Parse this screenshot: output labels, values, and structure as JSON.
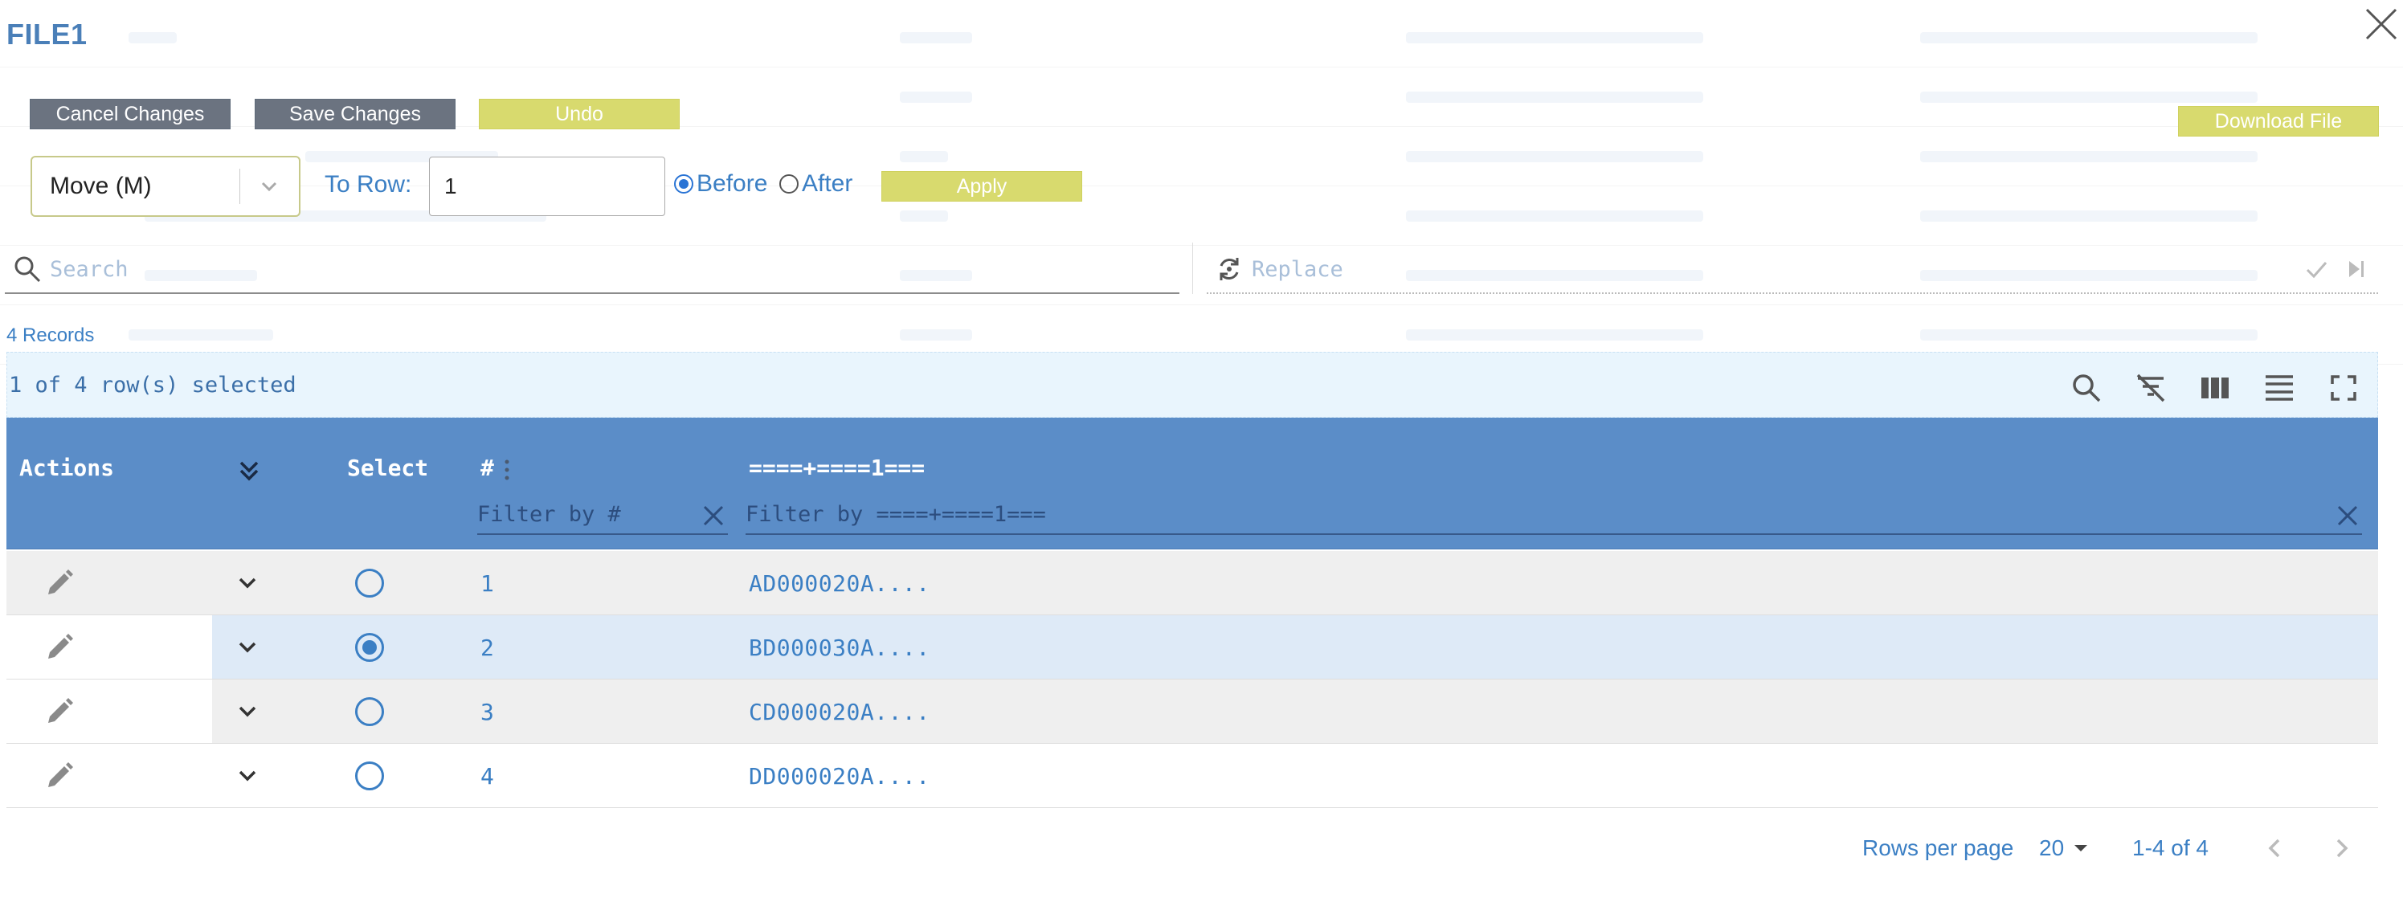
{
  "window": {
    "title": "FILE1"
  },
  "toolbar": {
    "cancel_label": "Cancel Changes",
    "save_label": "Save Changes",
    "undo_label": "Undo",
    "download_label": "Download File"
  },
  "move": {
    "operation": "Move (M)",
    "to_row_label": "To Row:",
    "to_row_value": "1",
    "before_label": "Before",
    "after_label": "After",
    "position_selected": "Before",
    "apply_label": "Apply"
  },
  "search": {
    "placeholder": "Search"
  },
  "replace": {
    "placeholder": "Replace"
  },
  "records_label": "4 Records",
  "selection_text": "1 of 4 row(s) selected",
  "table": {
    "headers": {
      "actions": "Actions",
      "select": "Select",
      "num": "#",
      "col1": "====+====1==="
    },
    "filters": {
      "num_placeholder": "Filter by #",
      "col1_placeholder": "Filter by ====+====1==="
    },
    "rows": [
      {
        "num": "1",
        "value": "AD000020A....",
        "selected": false
      },
      {
        "num": "2",
        "value": "BD000030A....",
        "selected": true
      },
      {
        "num": "3",
        "value": "CD000020A....",
        "selected": false
      },
      {
        "num": "4",
        "value": "DD000020A....",
        "selected": false
      }
    ]
  },
  "pagination": {
    "rows_per_page_label": "Rows per page",
    "rows_per_page_value": "20",
    "range": "1-4 of 4"
  },
  "colors": {
    "header_bg": "#5b8dc8",
    "accent_yellow": "#d8da6e",
    "button_gray": "#6b7380",
    "text_blue": "#3b7fc4",
    "selected_row_bg": "#deeaf7",
    "alt_row_bg": "#efefef",
    "banner_bg": "#e9f5fd"
  },
  "icons": {
    "close": "close-icon",
    "search": "search-icon",
    "replace": "replace-icon",
    "confirm": "check-icon",
    "skip": "skip-next-icon",
    "toolbar": [
      "search-icon",
      "filter-off-icon",
      "columns-icon",
      "density-icon",
      "fullscreen-icon"
    ],
    "edit": "pencil-icon",
    "expand": "chevron-down-icon",
    "expand_all": "double-chevron-down-icon"
  }
}
